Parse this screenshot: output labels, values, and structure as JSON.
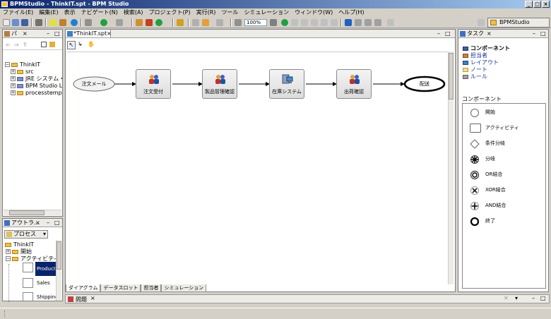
{
  "window": {
    "title": "BPMStudio - ThinkIT.spt - BPM Studio"
  },
  "menu": [
    "ファイル(E)",
    "編集(E)",
    "表示",
    "ナビゲート(N)",
    "検索(A)",
    "プロジェクト(P)",
    "実行(R)",
    "ツール",
    "シミュレーション",
    "ウィンドウ(W)",
    "ヘルプ(H)"
  ],
  "toolbar": {
    "zoom": "100%",
    "perspective": "BPMStudio"
  },
  "package_view": {
    "title": "パ",
    "items": [
      {
        "label": "ThinkIT",
        "level": 0,
        "expander": "−"
      },
      {
        "label": "src",
        "level": 1,
        "expander": "+"
      },
      {
        "label": "JRE システム・ラ",
        "level": 1,
        "expander": "+"
      },
      {
        "label": "BPM Studio Libi",
        "level": 1,
        "expander": "+"
      },
      {
        "label": "processtemplate",
        "level": 1,
        "expander": "+"
      }
    ]
  },
  "outline_view": {
    "title": "アウトラ…",
    "selector": "プロセス",
    "items": [
      {
        "label": "ThinkIT",
        "level": 0
      },
      {
        "label": "開始",
        "level": 1
      },
      {
        "label": "アクティビティ",
        "level": 1
      }
    ],
    "thumbs": [
      "Products",
      "Sales",
      "Shipping"
    ]
  },
  "editor": {
    "tab": "*ThinkIT.spt",
    "nodes": {
      "start": "注文メール",
      "order": "注文受付",
      "product": "製品管理確認",
      "stock": "在庫システム",
      "shipping": "出荷確認",
      "end": "配送"
    },
    "bottom_tabs": [
      "ダイアグラム",
      "データスロット",
      "担当者",
      "シミュレーション"
    ]
  },
  "problems": {
    "title": "問題"
  },
  "task_view": {
    "title": "タスク",
    "tree": {
      "root": "コンポーネント",
      "items": [
        "担当者",
        "レイアウト",
        "ノート",
        "ルール"
      ]
    },
    "palette_title": "コンポーネント",
    "palette": [
      {
        "icon": "circle-icon",
        "label": "開始"
      },
      {
        "icon": "rectangle-icon",
        "label": "アクティビティ"
      },
      {
        "icon": "diamond-icon",
        "label": "条件分岐"
      },
      {
        "icon": "star-branch-icon",
        "label": "分岐"
      },
      {
        "icon": "or-merge-icon",
        "label": "OR結合"
      },
      {
        "icon": "xor-merge-icon",
        "label": "XOR結合"
      },
      {
        "icon": "and-merge-icon",
        "label": "AND結合"
      },
      {
        "icon": "end-circle-icon",
        "label": "終了"
      }
    ]
  },
  "colors": {
    "titlebar": "#0a246a",
    "selection": "#0a246a",
    "link": "#1a3a9a"
  }
}
